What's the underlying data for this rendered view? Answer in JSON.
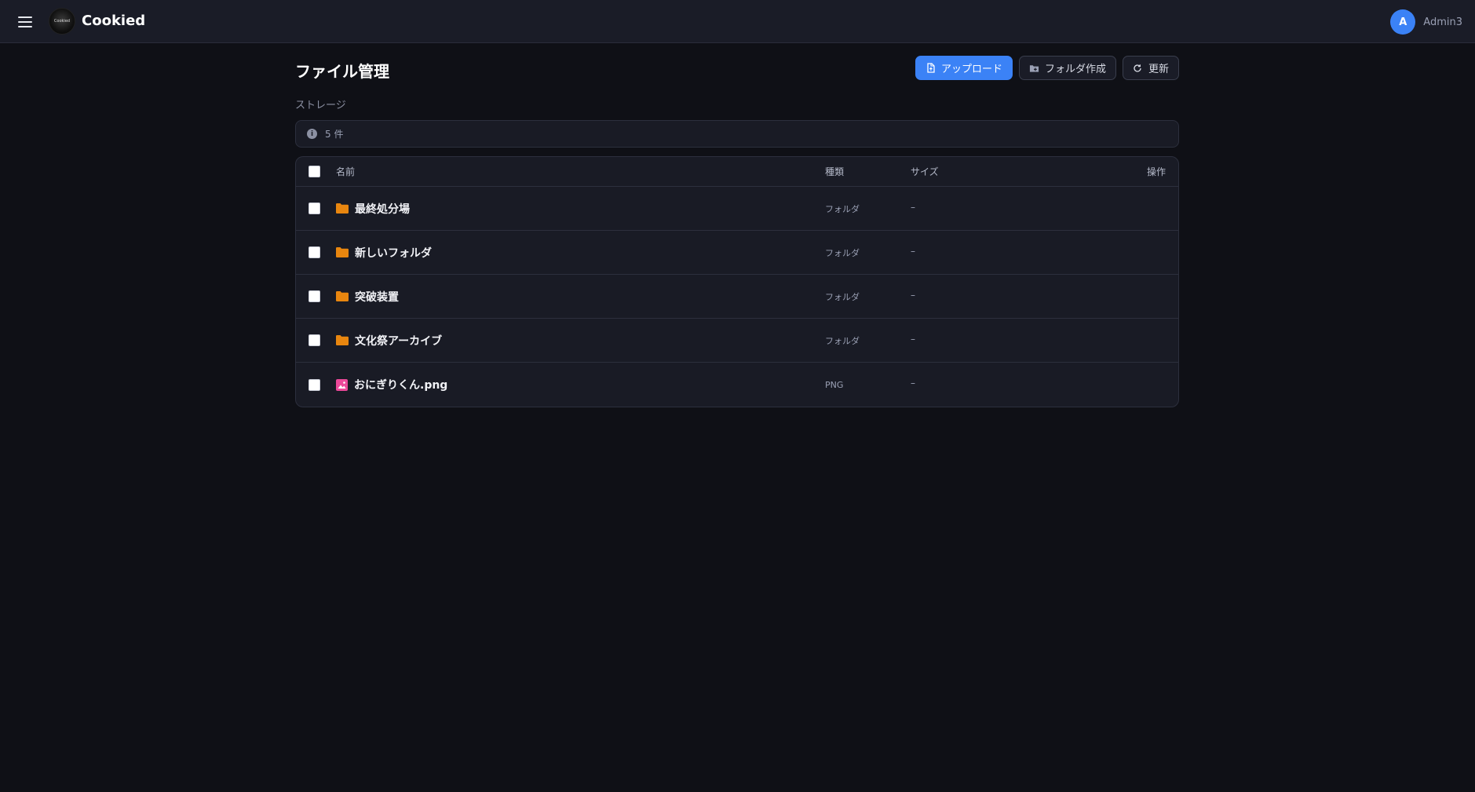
{
  "header": {
    "app_title": "Cookied",
    "logo_text": "Cookied",
    "user": {
      "avatar_letter": "A",
      "name": "Admin3"
    }
  },
  "page": {
    "title": "ファイル管理",
    "breadcrumb": "ストレージ",
    "count_text": "5 件"
  },
  "toolbar": {
    "upload_label": "アップロード",
    "new_folder_label": "フォルダ作成",
    "refresh_label": "更新"
  },
  "table": {
    "columns": {
      "name": "名前",
      "type": "種類",
      "size": "サイズ",
      "actions": "操作"
    },
    "rows": [
      {
        "name": "最終処分場",
        "type": "フォルダ",
        "size": "–",
        "icon": "folder-icon"
      },
      {
        "name": "新しいフォルダ",
        "type": "フォルダ",
        "size": "–",
        "icon": "folder-icon"
      },
      {
        "name": "突破装置",
        "type": "フォルダ",
        "size": "–",
        "icon": "folder-icon"
      },
      {
        "name": "文化祭アーカイブ",
        "type": "フォルダ",
        "size": "–",
        "icon": "folder-icon"
      },
      {
        "name": "おにぎりくん.png",
        "type": "PNG",
        "size": "–",
        "icon": "image-icon"
      }
    ]
  },
  "colors": {
    "accent": "#3b82f6",
    "folder": "#e8860f",
    "image": "#ec4899",
    "background": "#0f1016",
    "surface": "#191b25"
  }
}
